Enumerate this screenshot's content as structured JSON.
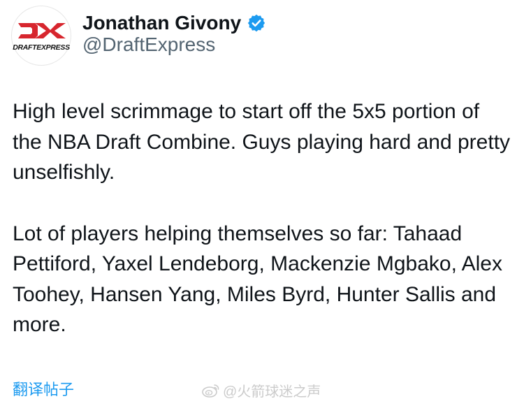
{
  "author": {
    "display_name": "Jonathan Givony",
    "handle": "@DraftExpress",
    "avatar_text": "DRAFTEXPRESS",
    "verified": true,
    "verified_color": "#1d9bf0"
  },
  "tweet": {
    "paragraphs": [
      "High level scrimmage to start off the 5x5 portion of the NBA Draft Combine. Guys playing hard and pretty unselfishly.",
      "Lot of players helping themselves so far: Tahaad Pettiford, Yaxel Lendeborg, Mackenzie Mgbako, Alex Toohey, Hansen Yang, Miles Byrd, Hunter Sallis and more."
    ]
  },
  "translate_link": "翻译帖子",
  "watermark": {
    "text": "@火箭球迷之声",
    "icon": "weibo-icon"
  },
  "colors": {
    "accent": "#1d9bf0",
    "text": "#0f1419",
    "secondary": "#536471",
    "logo_red": "#d7262e"
  }
}
